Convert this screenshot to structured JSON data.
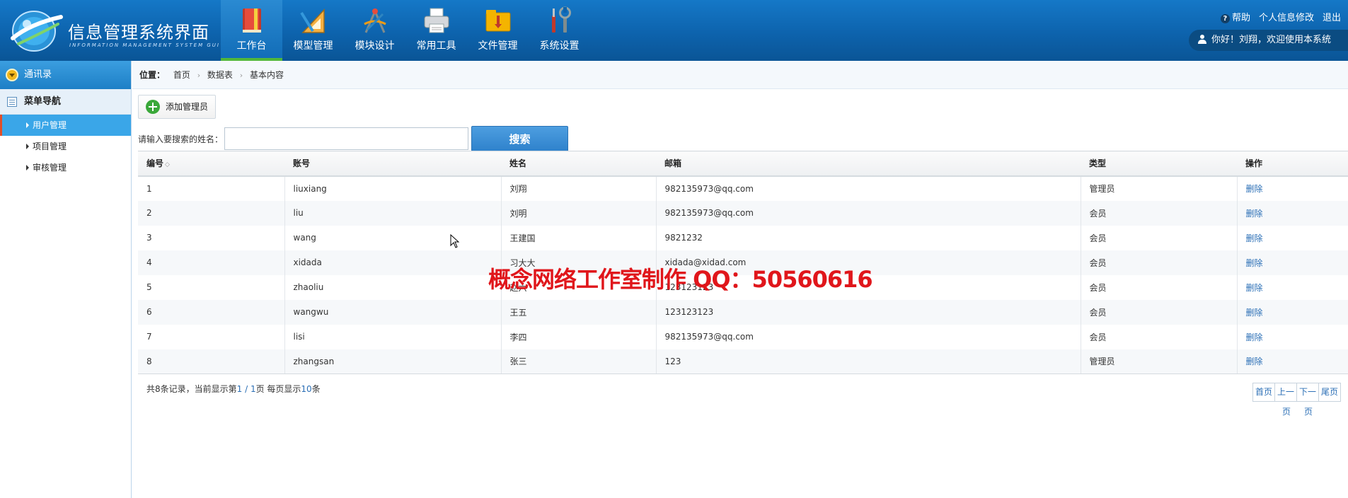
{
  "header": {
    "logo_title": "信息管理系统界面",
    "logo_subtitle": "INFORMATION MANAGEMENT SYSTEM GUI",
    "nav": [
      {
        "label": "工作台",
        "icon": "book-icon",
        "active": true
      },
      {
        "label": "模型管理",
        "icon": "ruler-triangle-icon",
        "active": false
      },
      {
        "label": "模块设计",
        "icon": "compass-design-icon",
        "active": false
      },
      {
        "label": "常用工具",
        "icon": "printer-icon",
        "active": false
      },
      {
        "label": "文件管理",
        "icon": "folder-icon",
        "active": false
      },
      {
        "label": "系统设置",
        "icon": "tools-icon",
        "active": false
      }
    ],
    "links": {
      "help": "帮助",
      "profile": "个人信息修改",
      "logout": "退出"
    },
    "welcome": "你好！刘翔，欢迎使用本系统"
  },
  "sidebar": {
    "header": "通讯录",
    "section": "菜单导航",
    "items": [
      {
        "label": "用户管理",
        "active": true
      },
      {
        "label": "项目管理",
        "active": false
      },
      {
        "label": "审核管理",
        "active": false
      }
    ]
  },
  "breadcrumb": {
    "label": "位置：",
    "items": [
      "首页",
      "数据表",
      "基本内容"
    ]
  },
  "toolbar": {
    "add_label": "添加管理员"
  },
  "search": {
    "label": "请输入要搜索的姓名：",
    "value": "",
    "button": "搜索"
  },
  "table": {
    "columns": [
      "编号",
      "账号",
      "姓名",
      "邮箱",
      "类型",
      "操作"
    ],
    "rows": [
      {
        "id": "1",
        "account": "liuxiang",
        "name": "刘翔",
        "email": "982135973@qq.com",
        "type": "管理员",
        "action": "删除"
      },
      {
        "id": "2",
        "account": "liu",
        "name": "刘明",
        "email": "982135973@qq.com",
        "type": "会员",
        "action": "删除"
      },
      {
        "id": "3",
        "account": "wang",
        "name": "王建国",
        "email": "9821232",
        "type": "会员",
        "action": "删除"
      },
      {
        "id": "4",
        "account": "xidada",
        "name": "习大大",
        "email": "xidada@xidad.com",
        "type": "会员",
        "action": "删除"
      },
      {
        "id": "5",
        "account": "zhaoliu",
        "name": "赵六",
        "email": "123123123",
        "type": "会员",
        "action": "删除"
      },
      {
        "id": "6",
        "account": "wangwu",
        "name": "王五",
        "email": "123123123",
        "type": "会员",
        "action": "删除"
      },
      {
        "id": "7",
        "account": "lisi",
        "name": "李四",
        "email": "982135973@qq.com",
        "type": "会员",
        "action": "删除"
      },
      {
        "id": "8",
        "account": "zhangsan",
        "name": "张三",
        "email": "123",
        "type": "管理员",
        "action": "删除"
      }
    ]
  },
  "footer": {
    "prefix": "共8条记录，当前显示第",
    "page": "1 / 1",
    "mid": "页 每页显示",
    "per_page": "10",
    "suffix": "条"
  },
  "pager": {
    "first": "首页",
    "prev": "上一",
    "next": "下一",
    "last": "尾页",
    "prev_wrap": "页",
    "next_wrap": "页"
  },
  "watermark": "概念网络工作室制作 QQ：50560616",
  "colors": {
    "header_blue": "#0d63ad",
    "active_green": "#52b83a",
    "sidebar_active": "#3aa6e8",
    "link_blue": "#2b6fb6",
    "watermark_red": "#e0161b"
  }
}
